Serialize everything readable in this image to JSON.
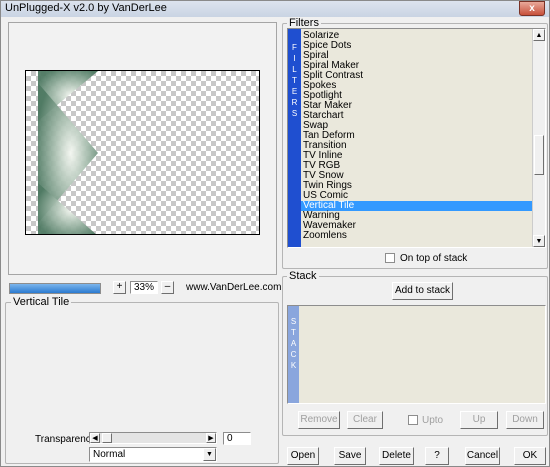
{
  "window": {
    "title": "UnPlugged-X v2.0 by VanDerLee",
    "close_label": "x"
  },
  "preview": {
    "progress_percent": 100,
    "zoom_in_label": "+",
    "zoom_value": "33%",
    "zoom_out_label": "–",
    "website": "www.VanDerLee.com"
  },
  "filter_panel": {
    "group_label": "Vertical Tile",
    "transparency_label": "Transparency",
    "transparency_value": "0",
    "blend_mode": "Normal"
  },
  "filters": {
    "group_label": "Filters",
    "tab_label": [
      "F",
      "I",
      "L",
      "T",
      "E",
      "R",
      "S"
    ],
    "items": [
      "Solarize",
      "Spice Dots",
      "Spiral",
      "Spiral Maker",
      "Split Contrast",
      "Spokes",
      "Spotlight",
      "Star Maker",
      "Starchart",
      "Swap",
      "Tan Deform",
      "Transition",
      "TV Inline",
      "TV RGB",
      "TV Snow",
      "Twin Rings",
      "US Comic",
      "Vertical Tile",
      "Warning",
      "Wavemaker",
      "Zoomlens"
    ],
    "selected": "Vertical Tile",
    "on_top_label": "On top of stack"
  },
  "stack": {
    "group_label": "Stack",
    "add_label": "Add to stack",
    "tab_label": [
      "S",
      "T",
      "A",
      "C",
      "K"
    ],
    "remove_label": "Remove",
    "clear_label": "Clear",
    "upto_label": "Upto",
    "up_label": "Up",
    "down_label": "Down"
  },
  "footer": {
    "open_label": "Open",
    "save_label": "Save",
    "delete_label": "Delete",
    "help_label": "?",
    "cancel_label": "Cancel",
    "ok_label": "OK"
  }
}
